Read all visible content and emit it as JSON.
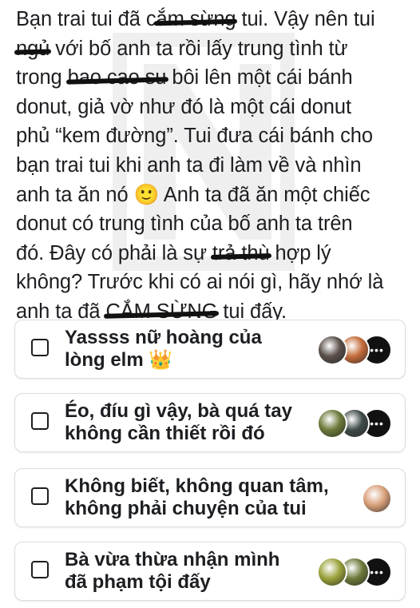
{
  "post": {
    "lines": [
      [
        "Bạn trai tui đã c",
        "ắm sừng",
        " tui. Vậy nên tui"
      ],
      [
        "",
        "ngủ",
        " với bố anh ta rồi lấy trung tình từ"
      ],
      [
        "trong ",
        "bao cao su",
        " bôi lên một cái bánh"
      ],
      [
        "donut, giả vờ như đó là một cái donut",
        "",
        ""
      ],
      [
        "phủ “kem đường”. Tui đưa cái bánh cho",
        "",
        ""
      ],
      [
        "bạn trai tui khi anh ta đi làm về và nhìn",
        "",
        ""
      ],
      [
        "anh ta ăn nó 🙂 Anh ta đã ăn một chiếc",
        "",
        ""
      ],
      [
        "donut có trung tình của bố anh ta trên",
        "",
        ""
      ],
      [
        "đó. Đây có phải là sự ",
        "trả thù",
        " hợp lý"
      ],
      [
        "không? Trước khi có ai nói gì, hãy nhớ là",
        "",
        ""
      ],
      [
        "anh ta đã ",
        "CẮM SỪNG",
        " tui đấy."
      ]
    ]
  },
  "poll": {
    "options": [
      {
        "line1": "Yassss nữ hoàng của",
        "line2": "lòng elm 👑",
        "avatar_colors": [
          "#5a4f4a",
          "#c46b3a",
          "#111111"
        ]
      },
      {
        "line1": "Éo, đíu gì vậy, bà quá tay",
        "line2": "không cần thiết rồi đó",
        "avatar_colors": [
          "#6b7a3a",
          "#3f4a4a",
          "#111111"
        ]
      },
      {
        "line1": "Không biết, không quan tâm,",
        "line2": "không phải chuyện của tui",
        "avatar_colors": [
          "#d9a07a"
        ]
      },
      {
        "line1": "Bà vừa thừa nhận mình",
        "line2": "đã phạm tội đấy",
        "avatar_colors": [
          "#9aa23a",
          "#6b7a3a",
          "#111111"
        ]
      }
    ],
    "more_label": "•••"
  }
}
